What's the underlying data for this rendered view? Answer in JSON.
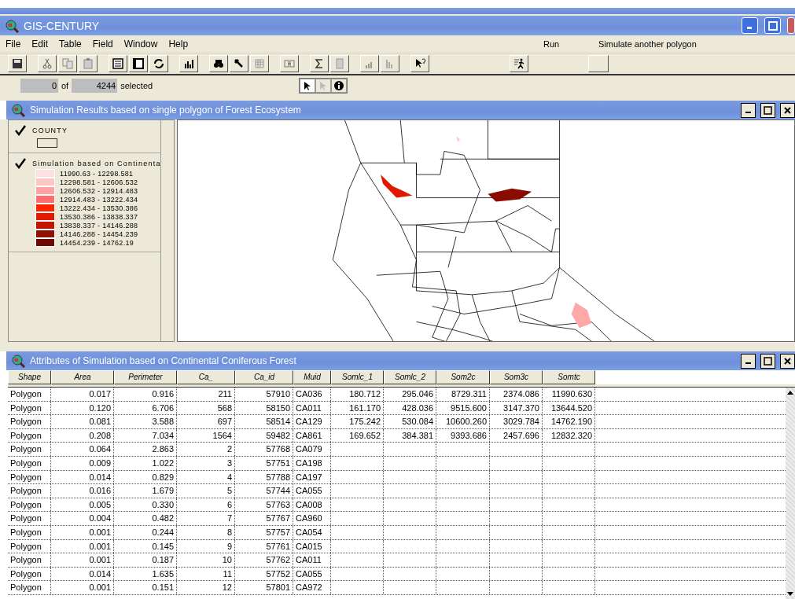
{
  "app": {
    "title": "GIS-CENTURY"
  },
  "menu": [
    {
      "label": "File"
    },
    {
      "label": "Edit"
    },
    {
      "label": "Table"
    },
    {
      "label": "Field"
    },
    {
      "label": "Window"
    },
    {
      "label": "Help"
    }
  ],
  "toolbar_labels": {
    "run": "Run",
    "simulate": "Simulate another polygon"
  },
  "selection": {
    "selected": "0",
    "of": "of",
    "total": "4244",
    "suffix": "selected"
  },
  "view_window": {
    "title": "Simulation Results based on single polygon of Forest Ecosystem",
    "legend": [
      {
        "kind": "outline",
        "name": "COUNTY",
        "checked": true
      },
      {
        "kind": "classes",
        "name": "Simulation based on Continenta",
        "checked": true,
        "classes": [
          {
            "label": "11990.63 - 12298.581",
            "color": "#fde0e2"
          },
          {
            "label": "12298.581 - 12606.532",
            "color": "#ffc6c6"
          },
          {
            "label": "12606.532 - 12914.483",
            "color": "#ffa2a2"
          },
          {
            "label": "12914.483 - 13222.434",
            "color": "#ff6e6e"
          },
          {
            "label": "13222.434 - 13530.386",
            "color": "#ff2200"
          },
          {
            "label": "13530.386 - 13838.337",
            "color": "#e41a00"
          },
          {
            "label": "13838.337 - 14146.288",
            "color": "#c41400"
          },
          {
            "label": "14146.288 - 14454.239",
            "color": "#921000"
          },
          {
            "label": "14454.239 - 14762.19",
            "color": "#6e0a00"
          }
        ]
      }
    ]
  },
  "table_window": {
    "title": "Attributes of Simulation based on Continental Coniferous Forest",
    "columns": [
      "Shape",
      "Area",
      "Perimeter",
      "Ca_",
      "Ca_id",
      "Muid",
      "Somlc_1",
      "Somlc_2",
      "Som2c",
      "Som3c",
      "Somtc"
    ],
    "rows": [
      [
        "Polygon",
        "0.017",
        "0.916",
        "211",
        "57910",
        "CA036",
        "180.712",
        "295.046",
        "8729.311",
        "2374.086",
        "11990.630"
      ],
      [
        "Polygon",
        "0.120",
        "6.706",
        "568",
        "58150",
        "CA011",
        "161.170",
        "428.036",
        "9515.600",
        "3147.370",
        "13644.520"
      ],
      [
        "Polygon",
        "0.081",
        "3.588",
        "697",
        "58514",
        "CA129",
        "175.242",
        "530.084",
        "10600.260",
        "3029.784",
        "14762.190"
      ],
      [
        "Polygon",
        "0.208",
        "7.034",
        "1564",
        "59482",
        "CA861",
        "169.652",
        "384.381",
        "9393.686",
        "2457.696",
        "12832.320"
      ],
      [
        "Polygon",
        "0.064",
        "2.863",
        "2",
        "57768",
        "CA079",
        "",
        "",
        "",
        "",
        ""
      ],
      [
        "Polygon",
        "0.009",
        "1.022",
        "3",
        "57751",
        "CA198",
        "",
        "",
        "",
        "",
        ""
      ],
      [
        "Polygon",
        "0.014",
        "0.829",
        "4",
        "57788",
        "CA197",
        "",
        "",
        "",
        "",
        ""
      ],
      [
        "Polygon",
        "0.016",
        "1.679",
        "5",
        "57744",
        "CA055",
        "",
        "",
        "",
        "",
        ""
      ],
      [
        "Polygon",
        "0.005",
        "0.330",
        "6",
        "57763",
        "CA008",
        "",
        "",
        "",
        "",
        ""
      ],
      [
        "Polygon",
        "0.004",
        "0.482",
        "7",
        "57767",
        "CA960",
        "",
        "",
        "",
        "",
        ""
      ],
      [
        "Polygon",
        "0.001",
        "0.244",
        "8",
        "57757",
        "CA054",
        "",
        "",
        "",
        "",
        ""
      ],
      [
        "Polygon",
        "0.001",
        "0.145",
        "9",
        "57761",
        "CA015",
        "",
        "",
        "",
        "",
        ""
      ],
      [
        "Polygon",
        "0.001",
        "0.187",
        "10",
        "57762",
        "CA011",
        "",
        "",
        "",
        "",
        ""
      ],
      [
        "Polygon",
        "0.014",
        "1.635",
        "11",
        "57752",
        "CA055",
        "",
        "",
        "",
        "",
        ""
      ],
      [
        "Polygon",
        "0.001",
        "0.151",
        "12",
        "57801",
        "CA972",
        "",
        "",
        "",
        "",
        ""
      ]
    ]
  }
}
